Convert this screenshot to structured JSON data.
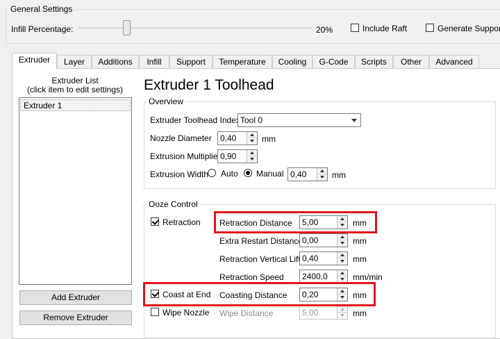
{
  "general_settings": {
    "title": "General Settings",
    "infill_label": "Infill Percentage:",
    "infill_value_text": "20%",
    "infill_fraction": 0.2,
    "include_raft_label": "Include Raft",
    "include_raft_checked": false,
    "generate_support_label": "Generate Support"
  },
  "tabs": [
    {
      "label": "Extruder",
      "active": true
    },
    {
      "label": "Layer"
    },
    {
      "label": "Additions"
    },
    {
      "label": "Infill"
    },
    {
      "label": "Support"
    },
    {
      "label": "Temperature"
    },
    {
      "label": "Cooling"
    },
    {
      "label": "G-Code"
    },
    {
      "label": "Scripts"
    },
    {
      "label": "Other"
    },
    {
      "label": "Advanced"
    }
  ],
  "extruder_list": {
    "title_line1": "Extruder List",
    "title_line2": "(click item to edit settings)",
    "items": [
      "Extruder 1"
    ],
    "add_button": "Add Extruder",
    "remove_button": "Remove Extruder"
  },
  "heading": "Extruder 1 Toolhead",
  "overview": {
    "title": "Overview",
    "toolhead_index_label": "Extruder Toolhead Index",
    "toolhead_index_value": "Tool 0",
    "nozzle_diameter_label": "Nozzle Diameter",
    "nozzle_diameter_value": "0,40",
    "nozzle_diameter_unit": "mm",
    "extrusion_multiplier_label": "Extrusion Multiplier",
    "extrusion_multiplier_value": "0,90",
    "extrusion_width_label": "Extrusion Width",
    "auto_label": "Auto",
    "manual_label": "Manual",
    "extrusion_width_value": "0,40",
    "extrusion_width_unit": "mm"
  },
  "ooze_control": {
    "title": "Ooze Control",
    "retraction_label": "Retraction",
    "retraction_checked": true,
    "retraction_distance_label": "Retraction Distance",
    "retraction_distance_value": "5,00",
    "retraction_distance_unit": "mm",
    "extra_restart_label": "Extra Restart Distance",
    "extra_restart_value": "0,00",
    "extra_restart_unit": "mm",
    "vertical_lift_label": "Retraction Vertical Lift",
    "vertical_lift_value": "0,40",
    "vertical_lift_unit": "mm",
    "retraction_speed_label": "Retraction Speed",
    "retraction_speed_value": "2400,0",
    "retraction_speed_unit": "mm/min",
    "coast_label": "Coast at End",
    "coast_checked": true,
    "coasting_distance_label": "Coasting Distance",
    "coasting_distance_value": "0,20",
    "coasting_distance_unit": "mm",
    "wipe_nozzle_label": "Wipe Nozzle",
    "wipe_nozzle_checked": false,
    "wipe_distance_label": "Wipe Distance",
    "wipe_distance_value": "5,00",
    "wipe_distance_unit": "mm"
  },
  "colors": {
    "highlight": "#e0141e",
    "window_bg": "#f0f0f0",
    "panel_bg": "#ffffff"
  }
}
